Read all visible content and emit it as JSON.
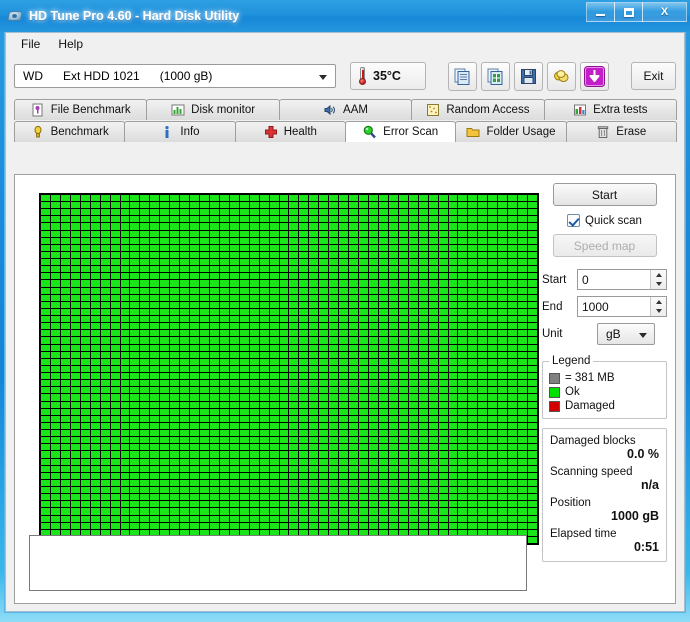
{
  "window": {
    "title": "HD Tune Pro 4.60 - Hard Disk Utility",
    "icon": "hard-disk-icon",
    "minimize": "–",
    "maximize": "□",
    "close": "X"
  },
  "menu": {
    "items": [
      {
        "label": "File"
      },
      {
        "label": "Help"
      }
    ]
  },
  "toolbar": {
    "drive": {
      "vendor": "WD",
      "model": "Ext HDD 1021",
      "capacity": "(1000 gB)"
    },
    "temperature": "35°C",
    "temperature_icon": "thermometer-icon",
    "buttons": [
      {
        "name": "copy-icon",
        "title": "Copy"
      },
      {
        "name": "export-icon",
        "title": "Export"
      },
      {
        "name": "save-icon",
        "title": "Save"
      },
      {
        "name": "settings-icon",
        "title": "Options"
      },
      {
        "name": "download-icon",
        "title": "Update"
      }
    ],
    "exit_label": "Exit"
  },
  "tabs": {
    "row1": [
      {
        "label": "File Benchmark",
        "icon": "file-benchmark-icon",
        "active": false
      },
      {
        "label": "Disk monitor",
        "icon": "disk-monitor-icon",
        "active": false
      },
      {
        "label": "AAM",
        "icon": "speaker-icon",
        "active": false
      },
      {
        "label": "Random Access",
        "icon": "random-access-icon",
        "active": false
      },
      {
        "label": "Extra tests",
        "icon": "extra-tests-icon",
        "active": false
      }
    ],
    "row2": [
      {
        "label": "Benchmark",
        "icon": "benchmark-icon",
        "active": false
      },
      {
        "label": "Info",
        "icon": "info-icon",
        "active": false
      },
      {
        "label": "Health",
        "icon": "health-cross-icon",
        "active": false
      },
      {
        "label": "Error Scan",
        "icon": "magnifier-icon",
        "active": true
      },
      {
        "label": "Folder Usage",
        "icon": "folder-icon",
        "active": false
      },
      {
        "label": "Erase",
        "icon": "trash-icon",
        "active": false
      }
    ]
  },
  "panel": {
    "start_label": "Start",
    "quick_scan_label": "Quick scan",
    "quick_scan_checked": true,
    "speed_map_label": "Speed map",
    "speed_map_enabled": false,
    "start_field_label": "Start",
    "start_field_value": "0",
    "end_field_label": "End",
    "end_field_value": "1000",
    "unit_label": "Unit",
    "unit_value": "gB"
  },
  "legend": {
    "title": "Legend",
    "block_size": "= 381 MB",
    "block_color": "#808080",
    "ok_label": "Ok",
    "ok_color": "#00e000",
    "damaged_label": "Damaged",
    "damaged_color": "#d00000"
  },
  "stats": {
    "damaged_blocks_label": "Damaged blocks",
    "damaged_blocks_value": "0.0 %",
    "scanning_speed_label": "Scanning speed",
    "scanning_speed_value": "n/a",
    "position_label": "Position",
    "position_value": "1000 gB",
    "elapsed_time_label": "Elapsed time",
    "elapsed_time_value": "0:51"
  },
  "blockmap": {
    "columns": 50,
    "rows": 49,
    "ok_color": "#19e519",
    "grid_color": "#000000",
    "damaged_indices": []
  },
  "log": {
    "text": ""
  }
}
